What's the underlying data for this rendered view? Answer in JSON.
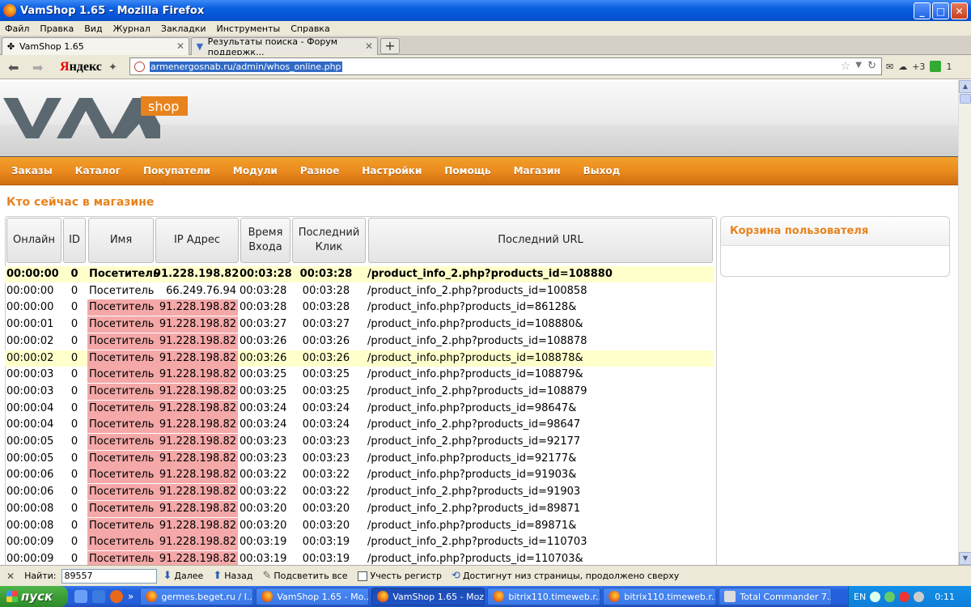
{
  "window": {
    "title": "VamShop 1.65 - Mozilla Firefox",
    "buttons": [
      "_",
      "□",
      "✕"
    ]
  },
  "menu": [
    "Файл",
    "Правка",
    "Вид",
    "Журнал",
    "Закладки",
    "Инструменты",
    "Справка"
  ],
  "tabs": [
    {
      "label": "VamShop 1.65",
      "active": true
    },
    {
      "label": "Результаты поиска - Форум поддержк...",
      "active": false
    }
  ],
  "navbar": {
    "url": "armenergosnab.ru/admin/whos_online.php",
    "yandex_ya": "Я",
    "yandex_rest": "ндекс",
    "right_count": "+3",
    "right_count2": "1"
  },
  "logo": {
    "shop": "shop"
  },
  "topnav": [
    "Заказы",
    "Каталог",
    "Покупатели",
    "Модули",
    "Разное",
    "Настройки",
    "Помощь",
    "Магазин",
    "Выход"
  ],
  "page_title": "Кто сейчас в магазине",
  "columns": {
    "online": "Онлайн",
    "id": "ID",
    "name": "Имя",
    "ip": "IP Адрес",
    "time": "Время Вход",
    "time_l1": "Время",
    "time_l2": "Входа",
    "click_l1": "Последний",
    "click_l2": "Клик",
    "url": "Последний URL"
  },
  "rows": [
    {
      "online": "00:00:00",
      "id": "0",
      "name": "Посетитель",
      "ip": "91.228.198.82",
      "time": "00:03:28",
      "click": "00:03:28",
      "url": "/product_info_2.php?products_id=108880",
      "highlight": true,
      "bold": true,
      "pink": false
    },
    {
      "online": "00:00:00",
      "id": "0",
      "name": "Посетитель",
      "ip": "66.249.76.94",
      "time": "00:03:28",
      "click": "00:03:28",
      "url": "/product_info_2.php?products_id=100858",
      "highlight": false,
      "bold": false,
      "pink": false
    },
    {
      "online": "00:00:00",
      "id": "0",
      "name": "Посетитель",
      "ip": "91.228.198.82",
      "time": "00:03:28",
      "click": "00:03:28",
      "url": "/product_info.php?products_id=86128&",
      "highlight": false,
      "bold": false,
      "pink": true
    },
    {
      "online": "00:00:01",
      "id": "0",
      "name": "Посетитель",
      "ip": "91.228.198.82",
      "time": "00:03:27",
      "click": "00:03:27",
      "url": "/product_info.php?products_id=108880&",
      "highlight": false,
      "bold": false,
      "pink": true
    },
    {
      "online": "00:00:02",
      "id": "0",
      "name": "Посетитель",
      "ip": "91.228.198.82",
      "time": "00:03:26",
      "click": "00:03:26",
      "url": "/product_info_2.php?products_id=108878",
      "highlight": false,
      "bold": false,
      "pink": true
    },
    {
      "online": "00:00:02",
      "id": "0",
      "name": "Посетитель",
      "ip": "91.228.198.82",
      "time": "00:03:26",
      "click": "00:03:26",
      "url": "/product_info.php?products_id=108878&",
      "highlight": true,
      "bold": false,
      "pink": true
    },
    {
      "online": "00:00:03",
      "id": "0",
      "name": "Посетитель",
      "ip": "91.228.198.82",
      "time": "00:03:25",
      "click": "00:03:25",
      "url": "/product_info.php?products_id=108879&",
      "highlight": false,
      "bold": false,
      "pink": true
    },
    {
      "online": "00:00:03",
      "id": "0",
      "name": "Посетитель",
      "ip": "91.228.198.82",
      "time": "00:03:25",
      "click": "00:03:25",
      "url": "/product_info_2.php?products_id=108879",
      "highlight": false,
      "bold": false,
      "pink": true
    },
    {
      "online": "00:00:04",
      "id": "0",
      "name": "Посетитель",
      "ip": "91.228.198.82",
      "time": "00:03:24",
      "click": "00:03:24",
      "url": "/product_info.php?products_id=98647&",
      "highlight": false,
      "bold": false,
      "pink": true
    },
    {
      "online": "00:00:04",
      "id": "0",
      "name": "Посетитель",
      "ip": "91.228.198.82",
      "time": "00:03:24",
      "click": "00:03:24",
      "url": "/product_info_2.php?products_id=98647",
      "highlight": false,
      "bold": false,
      "pink": true
    },
    {
      "online": "00:00:05",
      "id": "0",
      "name": "Посетитель",
      "ip": "91.228.198.82",
      "time": "00:03:23",
      "click": "00:03:23",
      "url": "/product_info_2.php?products_id=92177",
      "highlight": false,
      "bold": false,
      "pink": true
    },
    {
      "online": "00:00:05",
      "id": "0",
      "name": "Посетитель",
      "ip": "91.228.198.82",
      "time": "00:03:23",
      "click": "00:03:23",
      "url": "/product_info.php?products_id=92177&",
      "highlight": false,
      "bold": false,
      "pink": true
    },
    {
      "online": "00:00:06",
      "id": "0",
      "name": "Посетитель",
      "ip": "91.228.198.82",
      "time": "00:03:22",
      "click": "00:03:22",
      "url": "/product_info.php?products_id=91903&",
      "highlight": false,
      "bold": false,
      "pink": true
    },
    {
      "online": "00:00:06",
      "id": "0",
      "name": "Посетитель",
      "ip": "91.228.198.82",
      "time": "00:03:22",
      "click": "00:03:22",
      "url": "/product_info_2.php?products_id=91903",
      "highlight": false,
      "bold": false,
      "pink": true
    },
    {
      "online": "00:00:08",
      "id": "0",
      "name": "Посетитель",
      "ip": "91.228.198.82",
      "time": "00:03:20",
      "click": "00:03:20",
      "url": "/product_info_2.php?products_id=89871",
      "highlight": false,
      "bold": false,
      "pink": true
    },
    {
      "online": "00:00:08",
      "id": "0",
      "name": "Посетитель",
      "ip": "91.228.198.82",
      "time": "00:03:20",
      "click": "00:03:20",
      "url": "/product_info.php?products_id=89871&",
      "highlight": false,
      "bold": false,
      "pink": true
    },
    {
      "online": "00:00:09",
      "id": "0",
      "name": "Посетитель",
      "ip": "91.228.198.82",
      "time": "00:03:19",
      "click": "00:03:19",
      "url": "/product_info_2.php?products_id=110703",
      "highlight": false,
      "bold": false,
      "pink": true
    },
    {
      "online": "00:00:09",
      "id": "0",
      "name": "Посетитель",
      "ip": "91.228.198.82",
      "time": "00:03:19",
      "click": "00:03:19",
      "url": "/product_info.php?products_id=110703&",
      "highlight": false,
      "bold": false,
      "pink": true
    }
  ],
  "cart_panel": {
    "title": "Корзина пользователя"
  },
  "findbar": {
    "label": "Найти:",
    "value": "89557",
    "next": "Далее",
    "prev": "Назад",
    "highlight": "Подсветить все",
    "match_case": "Учесть регистр",
    "status": "Достигнут низ страницы, продолжено сверху"
  },
  "taskbar": {
    "start": "пуск",
    "items": [
      {
        "label": "germes.beget.ru / I...",
        "active": false
      },
      {
        "label": "VamShop 1.65 - Mo...",
        "active": false
      },
      {
        "label": "VamShop 1.65 - Moz...",
        "active": true
      },
      {
        "label": "bitrix110.timeweb.r...",
        "active": false
      },
      {
        "label": "bitrix110.timeweb.r...",
        "active": false
      },
      {
        "label": "Total Commander 7....",
        "active": false
      }
    ],
    "lang": "EN",
    "clock": "0:11"
  },
  "colors": {
    "accent_orange": "#e8821c",
    "highlight_row": "#ffffcc",
    "pink_cell": "#f4a8a8"
  }
}
